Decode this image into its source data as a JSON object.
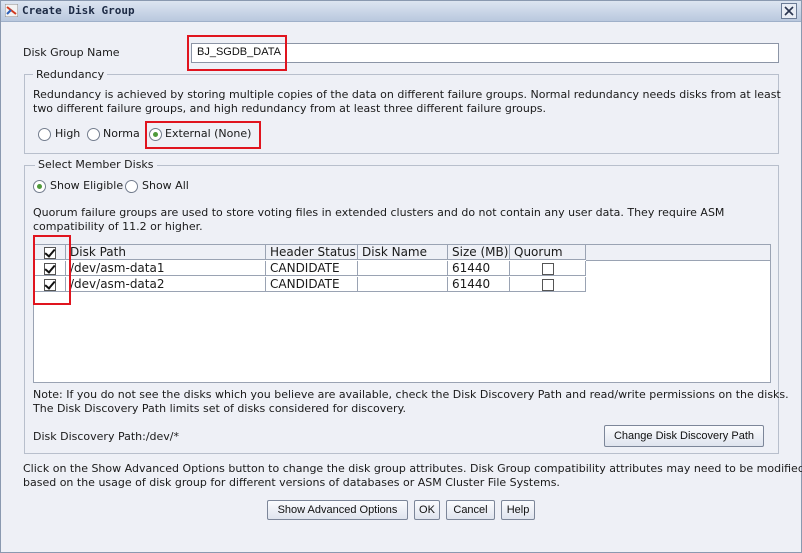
{
  "window": {
    "title": "Create Disk Group"
  },
  "disk_group_name": {
    "label": "Disk Group Name",
    "value": "BJ_SGDB_DATA"
  },
  "redundancy": {
    "legend": "Redundancy",
    "description_line1": "Redundancy is achieved by storing multiple copies of the data on different failure groups. Normal redundancy needs disks from at least",
    "description_line2": "two different failure groups, and high redundancy from at least three different failure groups.",
    "options": [
      "High",
      "Normal",
      "External (None)"
    ],
    "selected": "External (None)"
  },
  "member_disks": {
    "legend": "Select Member Disks",
    "filters": [
      "Show Eligible",
      "Show All"
    ],
    "selected_filter": "Show Eligible",
    "quorum_line1": "Quorum failure groups are used to store voting files in extended clusters and do not contain any user data. They require ASM",
    "quorum_line2": "compatibility of 11.2 or higher.",
    "table": {
      "columns": [
        "Disk Path",
        "Header Status",
        "Disk Name",
        "Size (MB)",
        "Quorum"
      ],
      "rows": [
        {
          "selected": true,
          "disk_path": "/dev/asm-data1",
          "header_status": "CANDIDATE",
          "disk_name": "",
          "size_mb": "61440",
          "quorum": false
        },
        {
          "selected": true,
          "disk_path": "/dev/asm-data2",
          "header_status": "CANDIDATE",
          "disk_name": "",
          "size_mb": "61440",
          "quorum": false
        }
      ]
    },
    "note_line1": "Note: If you do not see the disks which you believe are available, check the Disk Discovery Path and read/write permissions on the disks.",
    "note_line2": "The Disk Discovery Path limits set of disks considered for discovery.",
    "discovery_path": "Disk Discovery Path:/dev/*",
    "change_path_button": "Change Disk Discovery Path"
  },
  "advanced": {
    "line1": "Click on the Show Advanced Options button to change the disk group attributes. Disk Group compatibility attributes may need to be modified",
    "line2": "based on the usage of disk group for different versions of databases or ASM Cluster File Systems."
  },
  "buttons": {
    "advanced": "Show Advanced Options",
    "ok": "OK",
    "cancel": "Cancel",
    "help": "Help"
  },
  "colors": {
    "highlight": "#e0141e",
    "radio_selected": "#4f9a3a",
    "title_bar": "#c9d5e8",
    "background": "#eef0f6"
  }
}
